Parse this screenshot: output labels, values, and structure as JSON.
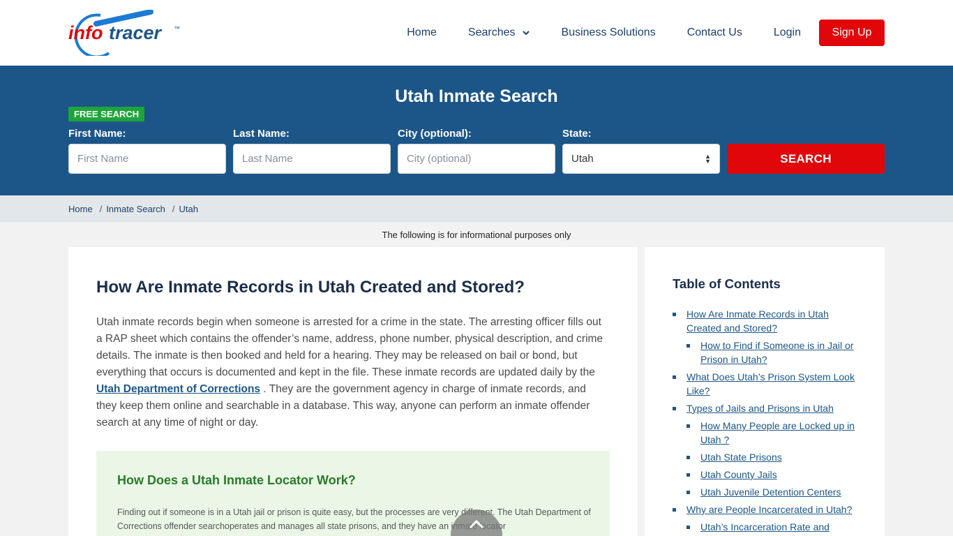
{
  "logo": {
    "text_info": "info",
    "text_tracer": "tracer",
    "tm": "™"
  },
  "nav": {
    "home": "Home",
    "searches": "Searches",
    "business": "Business Solutions",
    "contact": "Contact Us",
    "login": "Login",
    "signup": "Sign Up"
  },
  "search": {
    "title": "Utah Inmate Search",
    "badge": "FREE SEARCH",
    "first_label": "First Name:",
    "first_placeholder": "First Name",
    "last_label": "Last Name:",
    "last_placeholder": "Last Name",
    "city_label": "City (optional):",
    "city_placeholder": "City (optional)",
    "state_label": "State:",
    "state_value": "Utah",
    "button": "SEARCH"
  },
  "breadcrumb": {
    "home": "Home",
    "inmate": "Inmate Search",
    "state": "Utah",
    "sep": "/"
  },
  "disclaimer": "The following is for informational purposes only",
  "article": {
    "title": "How Are Inmate Records in Utah Created and Stored?",
    "intro_part1": "Utah inmate records begin when someone is arrested for a crime in the state. The arresting officer fills out a RAP sheet which contains the offender’s name, address, phone number, physical description, and crime details. The inmate is then booked and held for a hearing. They may be released on bail or bond, but everything that occurs is documented and kept in the file. These inmate records are updated daily by the ",
    "intro_link": "Utah Department of Corrections",
    "intro_part2": " . They are the government agency in charge of inmate records, and they keep them online and searchable in a database. This way, anyone can perform an inmate offender search at any time of night or day.",
    "callout_title": "How Does a Utah Inmate Locator Work?",
    "callout_text": "Finding out if someone is in a Utah jail or prison is quite easy, but the processes are very different. The Utah Department of Corrections offender searchoperates and manages all state prisons, and they have an inmate locator"
  },
  "toc": {
    "title": "Table of Contents",
    "items": [
      {
        "label": "How Are Inmate Records in Utah Created and Stored?"
      },
      {
        "label": "How to Find if Someone is in Jail or Prison in Utah?"
      },
      {
        "label": "What Does Utah’s Prison System Look Like?"
      },
      {
        "label": "Types of Jails and Prisons in Utah"
      },
      {
        "label": "How Many People are Locked up in Utah ?"
      },
      {
        "label": "Utah State Prisons"
      },
      {
        "label": "Utah County Jails"
      },
      {
        "label": "Utah Juvenile Detention Centers"
      },
      {
        "label": "Why are People Incarcerated in Utah?"
      },
      {
        "label": "Utah’s Incarceration Rate and"
      }
    ]
  },
  "colors": {
    "brand_blue": "#1c5689",
    "accent_red": "#e0060a",
    "badge_green": "#1ea53a"
  }
}
